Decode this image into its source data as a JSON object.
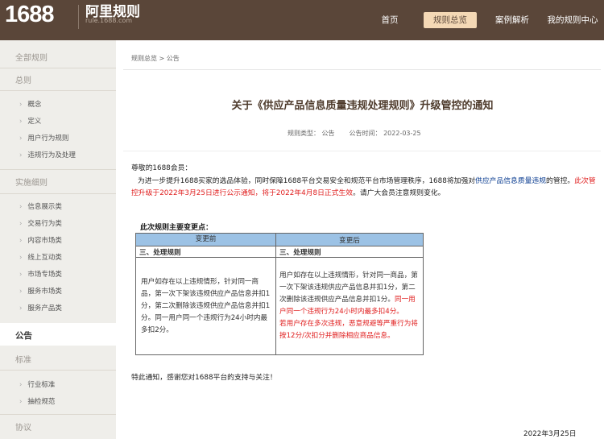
{
  "header": {
    "logo": "1688",
    "logo_sub": "阿里规则",
    "logo_url": "rule.1688.com",
    "nav": [
      "首页",
      "规则总览",
      "案例解析",
      "我的规则中心"
    ]
  },
  "sidebar": {
    "all_rules": "全部规则",
    "sections": [
      {
        "title": "总则",
        "items": [
          "概念",
          "定义",
          "用户行为规则",
          "违规行为及处理"
        ]
      },
      {
        "title": "实施细则",
        "items": [
          "信息展示类",
          "交易行为类",
          "内容市场类",
          "线上互动类",
          "市场专场类",
          "服务市场类",
          "服务产品类"
        ]
      },
      {
        "title": "公告",
        "items": []
      },
      {
        "title": "标准",
        "items": [
          "行业标准",
          "抽检规范"
        ]
      },
      {
        "title": "协议",
        "items": []
      }
    ]
  },
  "breadcrumb": "规则总览 > 公告",
  "title": "关于《供应产品信息质量违规处理规则》升级管控的通知",
  "meta": {
    "type": "规则类型：  公告",
    "time": "公告时间：  2022-03-25"
  },
  "body": {
    "greeting": "尊敬的1688会员：",
    "p1_a": "为进一步提升1688买家的选品体验，同时保障1688平台交易安全和规范平台市场管理秩序，1688将加强对",
    "p1_link": "供应产品信息质量违规",
    "p1_b": "的管控。",
    "p1_red": "此次管控升级于2022年3月25日进行公示通知，将于2022年4月8日正式生效",
    "p1_c": "。请广大会员注意规则变化。"
  },
  "table": {
    "title": "此次规则主要变更点：",
    "header_before": "变更前",
    "header_after": "变更后",
    "sub_before": "三、处理规则",
    "sub_after": "三、处理规则",
    "before_text": "用户如存在以上违规情形，针对同一商品，第一次下架该违规供应产品信息并扣1分，第二次删除该违规供应产品信息并扣1分。同一用户同一个违规行为24小时内最多扣2分。",
    "after_text_a": "用户如存在以上违规情形，针对同一商品，第一次下架该违规供应产品信息并扣1分，第二次删除该违规供应产品信息并扣1分。",
    "after_text_red1": "同一用户同一个违规行为24小时内最多扣4分。",
    "after_text_red2": "若用户存在多次违规，恶意规避等严重行为将按12分/次扣分并删除相应商品信息。"
  },
  "closing": "特此通知，感谢您对1688平台的支持与关注！",
  "date": "2022年3月25日"
}
